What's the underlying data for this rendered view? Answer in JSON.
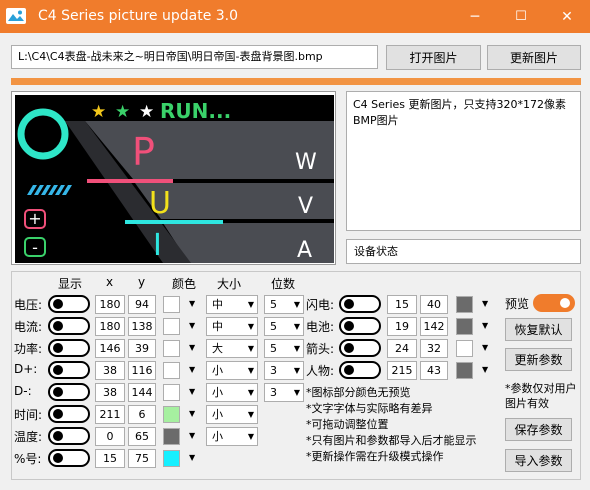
{
  "window": {
    "title": "C4 Series picture update 3.0",
    "minimize_glyph": "─",
    "maximize_glyph": "☐",
    "close_glyph": "✕",
    "accent_color": "#f07c2c"
  },
  "top": {
    "path_value": "L:\\C4\\C4表盘-战未来之~明日帝国\\明日帝国-表盘背景图.bmp",
    "open_button": "打开图片",
    "update_button": "更新图片",
    "progress_fraction": 0.0,
    "progress_color": "#f29443"
  },
  "preview": {
    "run_text": "RUN...",
    "star_colors": [
      "#f3c71b",
      "#3ad16a",
      "#ffffff"
    ],
    "letters": [
      "P",
      "U",
      "I"
    ],
    "letter_colors": [
      "#f0507a",
      "#f3e11b",
      "#2ee6e0"
    ],
    "right_letters": [
      "W",
      "V",
      "A"
    ],
    "plus": "+",
    "minus": "-"
  },
  "desc_text": "C4 Series 更新图片，只支持320*172像素BMP图片",
  "status_text": "设备状态",
  "headers": {
    "show": "显示",
    "x": "x",
    "y": "y",
    "color": "颜色",
    "size": "大小",
    "digits": "位数"
  },
  "rows_left": [
    {
      "label": "电压:",
      "x": "180",
      "y": "94",
      "color": "#ffffff",
      "size": "中",
      "digits": "5"
    },
    {
      "label": "电流:",
      "x": "180",
      "y": "138",
      "color": "#ffffff",
      "size": "中",
      "digits": "5"
    },
    {
      "label": "功率:",
      "x": "146",
      "y": "39",
      "color": "#ffffff",
      "size": "大",
      "digits": "5"
    },
    {
      "label": "D+:",
      "x": "38",
      "y": "116",
      "color": "#ffffff",
      "size": "小",
      "digits": "3"
    },
    {
      "label": "D-:",
      "x": "38",
      "y": "144",
      "color": "#ffffff",
      "size": "小",
      "digits": "3"
    },
    {
      "label": "时间:",
      "x": "211",
      "y": "6",
      "color": "#a6f0a0",
      "size": "小"
    },
    {
      "label": "温度:",
      "x": "0",
      "y": "65",
      "color": "#6b6b6b",
      "size": "小"
    },
    {
      "label": "%号:",
      "x": "15",
      "y": "75",
      "color": "#16f0ff"
    }
  ],
  "rows_right": [
    {
      "label": "闪电:",
      "x": "15",
      "y": "40",
      "color": "#6b6b6b"
    },
    {
      "label": "电池:",
      "x": "19",
      "y": "142",
      "color": "#6b6b6b"
    },
    {
      "label": "箭头:",
      "x": "24",
      "y": "32",
      "color": "#ffffff"
    },
    {
      "label": "人物:",
      "x": "215",
      "y": "43",
      "color": "#6b6b6b"
    }
  ],
  "notes": [
    "*图标部分颜色无预览",
    "*文字字体与实际略有差异",
    "*可拖动调整位置",
    "*只有图片和参数都导入后才能显示",
    "*更新操作需在升级模式操作"
  ],
  "side": {
    "preview_label": "预览",
    "restore_default": "恢复默认",
    "update_params": "更新参数",
    "note": "*参数仅对用户图片有效",
    "save_params": "保存参数",
    "import_params": "导入参数"
  }
}
